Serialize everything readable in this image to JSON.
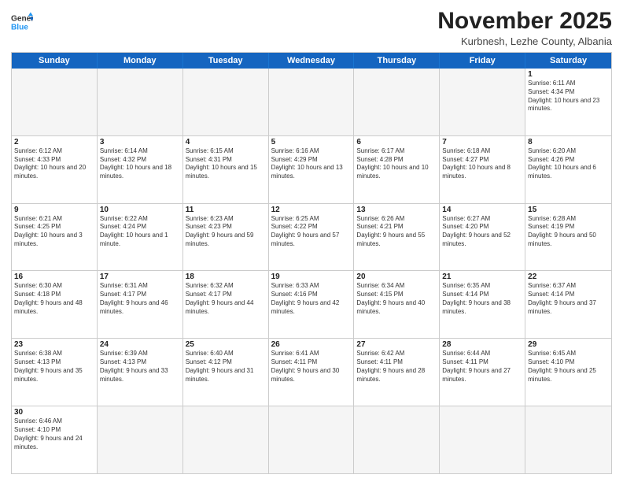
{
  "header": {
    "logo_line1": "General",
    "logo_line2": "Blue",
    "month": "November 2025",
    "location": "Kurbnesh, Lezhe County, Albania"
  },
  "days_of_week": [
    "Sunday",
    "Monday",
    "Tuesday",
    "Wednesday",
    "Thursday",
    "Friday",
    "Saturday"
  ],
  "weeks": [
    [
      {
        "day": "",
        "info": ""
      },
      {
        "day": "",
        "info": ""
      },
      {
        "day": "",
        "info": ""
      },
      {
        "day": "",
        "info": ""
      },
      {
        "day": "",
        "info": ""
      },
      {
        "day": "",
        "info": ""
      },
      {
        "day": "1",
        "info": "Sunrise: 6:11 AM\nSunset: 4:34 PM\nDaylight: 10 hours and 23 minutes."
      }
    ],
    [
      {
        "day": "2",
        "info": "Sunrise: 6:12 AM\nSunset: 4:33 PM\nDaylight: 10 hours and 20 minutes."
      },
      {
        "day": "3",
        "info": "Sunrise: 6:14 AM\nSunset: 4:32 PM\nDaylight: 10 hours and 18 minutes."
      },
      {
        "day": "4",
        "info": "Sunrise: 6:15 AM\nSunset: 4:31 PM\nDaylight: 10 hours and 15 minutes."
      },
      {
        "day": "5",
        "info": "Sunrise: 6:16 AM\nSunset: 4:29 PM\nDaylight: 10 hours and 13 minutes."
      },
      {
        "day": "6",
        "info": "Sunrise: 6:17 AM\nSunset: 4:28 PM\nDaylight: 10 hours and 10 minutes."
      },
      {
        "day": "7",
        "info": "Sunrise: 6:18 AM\nSunset: 4:27 PM\nDaylight: 10 hours and 8 minutes."
      },
      {
        "day": "8",
        "info": "Sunrise: 6:20 AM\nSunset: 4:26 PM\nDaylight: 10 hours and 6 minutes."
      }
    ],
    [
      {
        "day": "9",
        "info": "Sunrise: 6:21 AM\nSunset: 4:25 PM\nDaylight: 10 hours and 3 minutes."
      },
      {
        "day": "10",
        "info": "Sunrise: 6:22 AM\nSunset: 4:24 PM\nDaylight: 10 hours and 1 minute."
      },
      {
        "day": "11",
        "info": "Sunrise: 6:23 AM\nSunset: 4:23 PM\nDaylight: 9 hours and 59 minutes."
      },
      {
        "day": "12",
        "info": "Sunrise: 6:25 AM\nSunset: 4:22 PM\nDaylight: 9 hours and 57 minutes."
      },
      {
        "day": "13",
        "info": "Sunrise: 6:26 AM\nSunset: 4:21 PM\nDaylight: 9 hours and 55 minutes."
      },
      {
        "day": "14",
        "info": "Sunrise: 6:27 AM\nSunset: 4:20 PM\nDaylight: 9 hours and 52 minutes."
      },
      {
        "day": "15",
        "info": "Sunrise: 6:28 AM\nSunset: 4:19 PM\nDaylight: 9 hours and 50 minutes."
      }
    ],
    [
      {
        "day": "16",
        "info": "Sunrise: 6:30 AM\nSunset: 4:18 PM\nDaylight: 9 hours and 48 minutes."
      },
      {
        "day": "17",
        "info": "Sunrise: 6:31 AM\nSunset: 4:17 PM\nDaylight: 9 hours and 46 minutes."
      },
      {
        "day": "18",
        "info": "Sunrise: 6:32 AM\nSunset: 4:17 PM\nDaylight: 9 hours and 44 minutes."
      },
      {
        "day": "19",
        "info": "Sunrise: 6:33 AM\nSunset: 4:16 PM\nDaylight: 9 hours and 42 minutes."
      },
      {
        "day": "20",
        "info": "Sunrise: 6:34 AM\nSunset: 4:15 PM\nDaylight: 9 hours and 40 minutes."
      },
      {
        "day": "21",
        "info": "Sunrise: 6:35 AM\nSunset: 4:14 PM\nDaylight: 9 hours and 38 minutes."
      },
      {
        "day": "22",
        "info": "Sunrise: 6:37 AM\nSunset: 4:14 PM\nDaylight: 9 hours and 37 minutes."
      }
    ],
    [
      {
        "day": "23",
        "info": "Sunrise: 6:38 AM\nSunset: 4:13 PM\nDaylight: 9 hours and 35 minutes."
      },
      {
        "day": "24",
        "info": "Sunrise: 6:39 AM\nSunset: 4:13 PM\nDaylight: 9 hours and 33 minutes."
      },
      {
        "day": "25",
        "info": "Sunrise: 6:40 AM\nSunset: 4:12 PM\nDaylight: 9 hours and 31 minutes."
      },
      {
        "day": "26",
        "info": "Sunrise: 6:41 AM\nSunset: 4:11 PM\nDaylight: 9 hours and 30 minutes."
      },
      {
        "day": "27",
        "info": "Sunrise: 6:42 AM\nSunset: 4:11 PM\nDaylight: 9 hours and 28 minutes."
      },
      {
        "day": "28",
        "info": "Sunrise: 6:44 AM\nSunset: 4:11 PM\nDaylight: 9 hours and 27 minutes."
      },
      {
        "day": "29",
        "info": "Sunrise: 6:45 AM\nSunset: 4:10 PM\nDaylight: 9 hours and 25 minutes."
      }
    ],
    [
      {
        "day": "30",
        "info": "Sunrise: 6:46 AM\nSunset: 4:10 PM\nDaylight: 9 hours and 24 minutes."
      },
      {
        "day": "",
        "info": ""
      },
      {
        "day": "",
        "info": ""
      },
      {
        "day": "",
        "info": ""
      },
      {
        "day": "",
        "info": ""
      },
      {
        "day": "",
        "info": ""
      },
      {
        "day": "",
        "info": ""
      }
    ]
  ]
}
